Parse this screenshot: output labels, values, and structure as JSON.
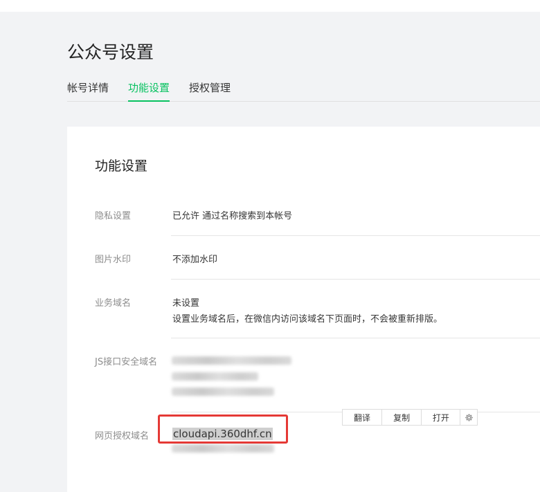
{
  "page": {
    "title": "公众号设置",
    "tabs": [
      {
        "label": "帐号详情",
        "active": false
      },
      {
        "label": "功能设置",
        "active": true
      },
      {
        "label": "授权管理",
        "active": false
      }
    ]
  },
  "panel": {
    "title": "功能设置",
    "rows": {
      "privacy": {
        "label": "隐私设置",
        "value": "已允许 通过名称搜索到本帐号"
      },
      "watermark": {
        "label": "图片水印",
        "value": "不添加水印"
      },
      "business_domain": {
        "label": "业务域名",
        "value": "未设置",
        "desc": "设置业务域名后，在微信内访问该域名下页面时，不会被重新排版。"
      },
      "js_domain": {
        "label": "JS接口安全域名"
      },
      "oauth_domain": {
        "label": "网页授权域名",
        "value": "cloudapi.360dhf.cn"
      }
    }
  },
  "context_menu": {
    "translate": "翻译",
    "copy": "复制",
    "open": "打开",
    "settings_icon": "gear-icon"
  },
  "colors": {
    "accent": "#07c160",
    "highlight": "#e53935"
  }
}
